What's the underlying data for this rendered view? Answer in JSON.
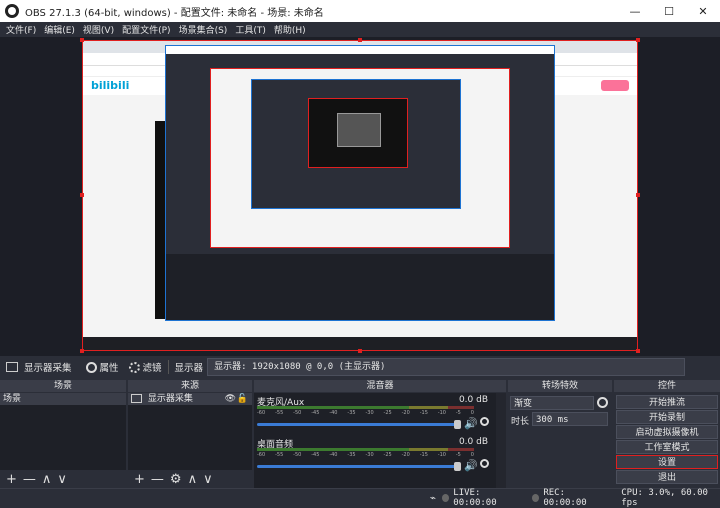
{
  "window": {
    "title": "OBS 27.1.3 (64-bit, windows) - 配置文件: 未命名 - 场景: 未命名",
    "controls": {
      "minimize": "—",
      "maximize": "☐",
      "close": "✕"
    }
  },
  "menu": [
    "文件(F)",
    "编辑(E)",
    "视图(V)",
    "配置文件(P)",
    "场景集合(S)",
    "工具(T)",
    "帮助(H)"
  ],
  "source_bar": {
    "source_name": "显示器采集",
    "properties_label": "属性",
    "filters_label": "滤镜",
    "display_label": "显示器",
    "display_value": "显示器: 1920x1080 @ 0,0 (主显示器)"
  },
  "scenes": {
    "header": "场景",
    "items": [
      "场景"
    ],
    "footer": [
      "+",
      "—",
      "∧",
      "∨"
    ]
  },
  "sources": {
    "header": "来源",
    "items": [
      "显示器采集"
    ],
    "footer": [
      "+",
      "—",
      "⚙",
      "∧",
      "∨"
    ]
  },
  "mixer": {
    "header": "混音器",
    "ticks": [
      "-60",
      "-55",
      "-50",
      "-45",
      "-40",
      "-35",
      "-30",
      "-25",
      "-20",
      "-15",
      "-10",
      "-5",
      "0"
    ],
    "channels": [
      {
        "name": "麦克风/Aux",
        "db": "0.0 dB",
        "volume": 1.0
      },
      {
        "name": "桌面音频",
        "db": "0.0 dB",
        "volume": 1.0
      }
    ]
  },
  "transitions": {
    "header": "转场特效",
    "type": "渐变",
    "duration_label": "时长",
    "duration_value": "300 ms"
  },
  "controls": {
    "header": "控件",
    "buttons": [
      "开始推流",
      "开始录制",
      "启动虚拟摄像机",
      "工作室模式",
      "设置",
      "退出"
    ],
    "highlighted": "设置"
  },
  "status": {
    "live": "LIVE: 00:00:00",
    "rec": "REC: 00:00:00",
    "cpu": "CPU: 3.0%, 60.00 fps"
  },
  "colors": {
    "background": "#2b2e38",
    "accent": "#3a7bd5",
    "selection_border": "#e02020"
  }
}
